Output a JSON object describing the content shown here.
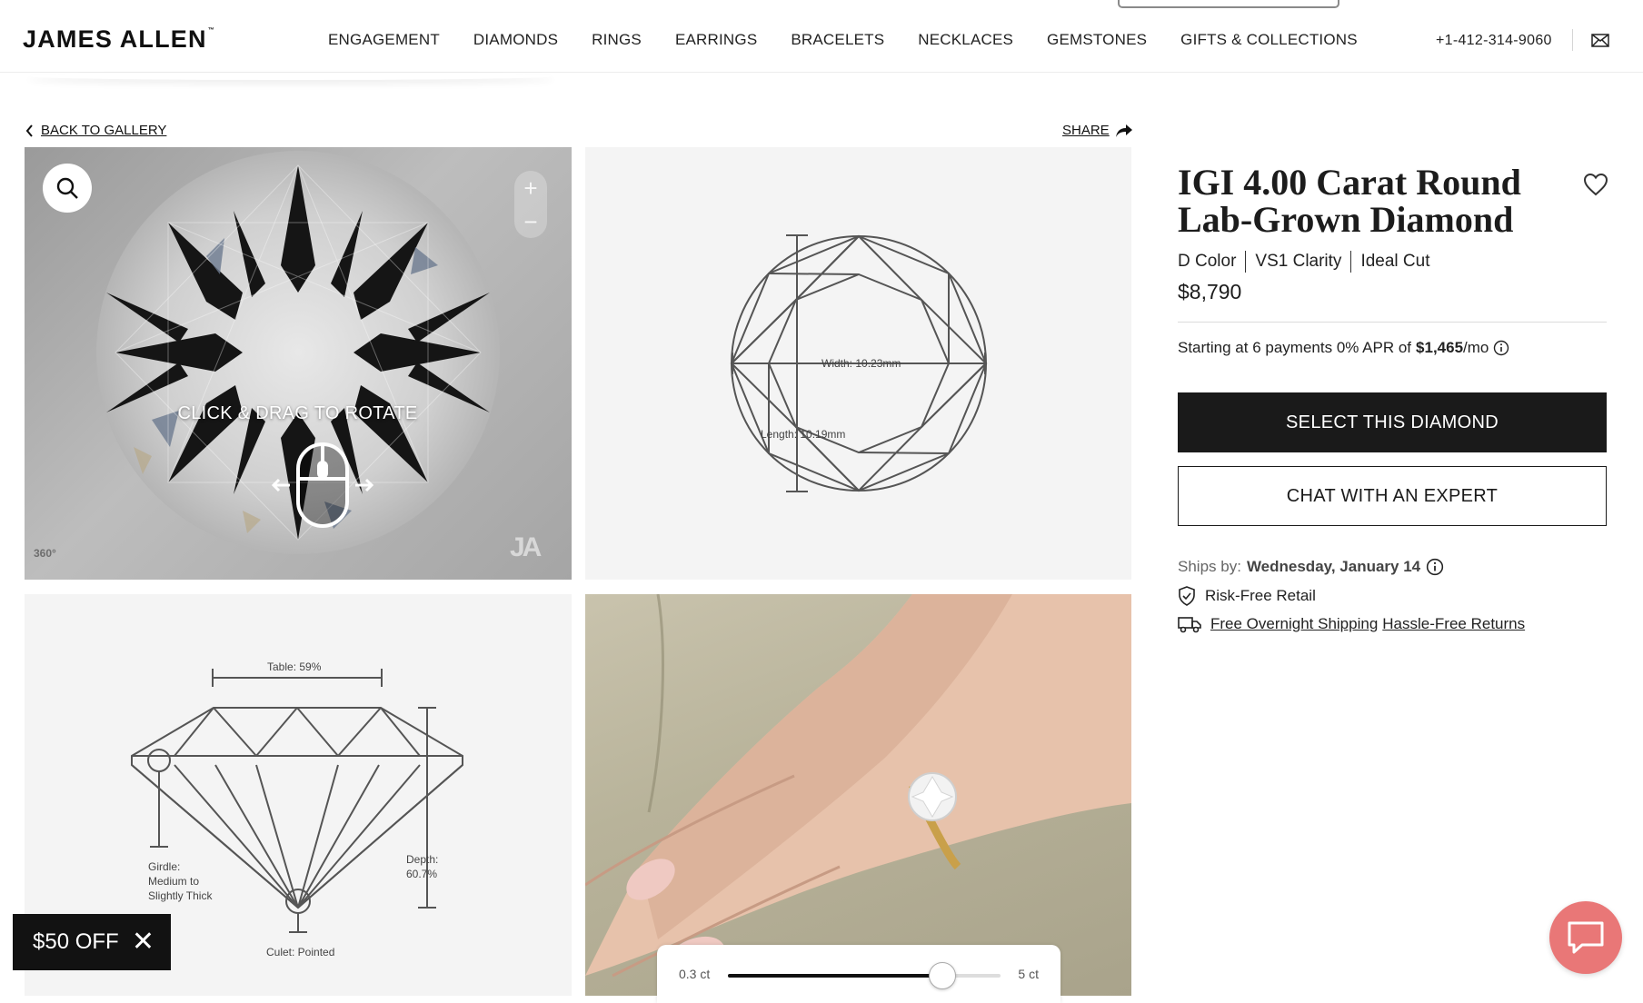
{
  "brand": {
    "logo": "JAMES ALLEN",
    "trademark": "™"
  },
  "nav": {
    "items": [
      "ENGAGEMENT",
      "DIAMONDS",
      "RINGS",
      "EARRINGS",
      "BRACELETS",
      "NECKLACES",
      "GEMSTONES",
      "GIFTS & COLLECTIONS"
    ],
    "phone": "+1-412-314-9060"
  },
  "gallery": {
    "back_label": "BACK TO GALLERY",
    "share_label": "SHARE",
    "viewer": {
      "hint": "CLICK & DRAG TO ROTATE",
      "badge_360": "360°",
      "watermark": "JA",
      "zoom_in": "+",
      "zoom_out": "−"
    },
    "top_diagram": {
      "width_label": "Width: 10.23mm",
      "length_label": "Length: 10.19mm"
    },
    "side_diagram": {
      "table_label": "Table: 59%",
      "depth_label_1": "Depth:",
      "depth_label_2": "60.7%",
      "girdle_label_1": "Girdle:",
      "girdle_label_2": "Medium to",
      "girdle_label_3": "Slightly Thick",
      "culet_label": "Culet: Pointed"
    },
    "carat_slider": {
      "min_label": "0.3 ct",
      "max_label": "5 ct",
      "value": 4.0,
      "min": 0.3,
      "max": 5.0
    }
  },
  "promo": {
    "label": "$50 OFF",
    "close": "✕"
  },
  "product": {
    "title": "IGI 4.00 Carat Round Lab-Grown Diamond",
    "color": "D Color",
    "clarity": "VS1 Clarity",
    "cut": "Ideal Cut",
    "price": "$8,790",
    "financing_prefix": "Starting at 6 payments 0% APR of",
    "financing_amount": "$1,465",
    "financing_suffix": "/mo",
    "select_button": "SELECT THIS DIAMOND",
    "chat_button": "CHAT WITH AN EXPERT",
    "ships_prefix": "Ships by:",
    "ships_date": "Wednesday, January 14",
    "perk_risk_free": "Risk-Free Retail",
    "perk_shipping": "Free Overnight Shipping",
    "perk_returns": "Hassle-Free Returns"
  },
  "colors": {
    "primary": "#1a1a1a",
    "chat_fab": "#e97777",
    "tile_bg": "#f4f4f4",
    "diagram_stroke": "#555555"
  },
  "icons": [
    "mail-icon",
    "chevron-left-icon",
    "share-arrow-icon",
    "magnifier-icon",
    "mouse-drag-icon",
    "heart-icon",
    "info-icon",
    "shield-check-icon",
    "truck-icon",
    "chat-bubble-icon",
    "close-icon"
  ]
}
